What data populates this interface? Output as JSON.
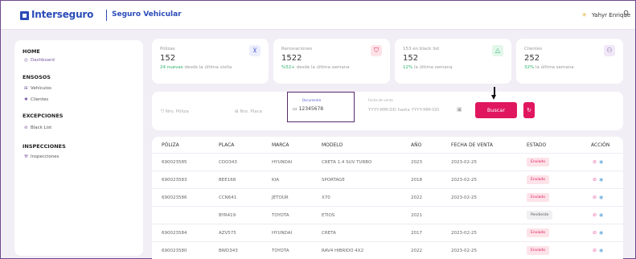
{
  "header": {
    "brand": "Interseguro",
    "product": "Seguro Vehicular",
    "user": "Yahyr Enrique"
  },
  "sidebar": {
    "sections": [
      {
        "title": "HOME",
        "items": [
          {
            "label": "Dashboard",
            "active": true,
            "icon": "dashboard-icon"
          }
        ]
      },
      {
        "title": "ENSOSOS",
        "items": [
          {
            "label": "Vehículos",
            "icon": "car-icon"
          },
          {
            "label": "Clientes",
            "icon": "users-icon"
          }
        ]
      },
      {
        "title": "EXCEPCIONES",
        "items": [
          {
            "label": "Black List",
            "icon": "block-icon"
          }
        ]
      },
      {
        "title": "INSPECCIONES",
        "items": [
          {
            "label": "Inspecciones",
            "icon": "wrench-icon"
          }
        ]
      }
    ]
  },
  "cards": [
    {
      "label": "Pólizas",
      "value": "152",
      "note_hl": "24 nuevas",
      "note": " desde la última visita",
      "icon_color": "#5a63d0",
      "icon_bg": "#eceefc",
      "hl_color": "#2db36c"
    },
    {
      "label": "Renovaciones",
      "value": "1522",
      "note_hl": "%52+",
      "note": " desde la última semana",
      "icon_color": "#e0175f",
      "icon_bg": "#fde3e8",
      "hl_color": "#2db36c"
    },
    {
      "label": "153 en black list",
      "value": "152",
      "note_hl": "12%",
      "note": " la última semana",
      "icon_color": "#2db36c",
      "icon_bg": "#e2f6ea",
      "hl_color": "#2db36c"
    },
    {
      "label": "Clientes",
      "value": "252",
      "note_hl": "32%",
      "note": " la última semana",
      "icon_color": "#7a5aa0",
      "icon_bg": "#f0e8f8",
      "hl_color": "#2db36c"
    }
  ],
  "filters": {
    "poliza_placeholder": "Nro. Póliza",
    "placa_placeholder": "Nro. Placa",
    "documento_label": "Documento",
    "documento_value": "12345678",
    "fecha_label": "Fecha de venta",
    "fecha_placeholder": "YYYY-MM-DD hasta YYYY-MM-DD",
    "search_label": "Buscar"
  },
  "table": {
    "columns": [
      "PÓLIZA",
      "PLACA",
      "MARCA",
      "MODELO",
      "AÑO",
      "FECHA DE VENTA",
      "ESTADO",
      "ACCIÓN"
    ],
    "rows": [
      {
        "poliza": "690023585",
        "placa": "CDO343",
        "marca": "HYUNDAI",
        "modelo": "CRETA 1.4 SUV TURBO",
        "anio": "2023",
        "fecha": "2023-02-25",
        "estado": "Enviado"
      },
      {
        "poliza": "690023583",
        "placa": "BEE168",
        "marca": "KIA",
        "modelo": "SPORTAGE",
        "anio": "2018",
        "fecha": "2023-02-25",
        "estado": "Enviado"
      },
      {
        "poliza": "690023586",
        "placa": "CCN641",
        "marca": "JETOUR",
        "modelo": "X70",
        "anio": "2022",
        "fecha": "2023-02-25",
        "estado": "Enviado"
      },
      {
        "poliza": "",
        "placa": "BYR419",
        "marca": "TOYOTA",
        "modelo": "ETIOS",
        "anio": "2021",
        "fecha": "",
        "estado": "Pendiente"
      },
      {
        "poliza": "690023584",
        "placa": "AZV575",
        "marca": "HYUNDAI",
        "modelo": "CRETA",
        "anio": "2017",
        "fecha": "2023-02-25",
        "estado": "Enviado"
      },
      {
        "poliza": "690023580",
        "placa": "BWD343",
        "marca": "TOYOTA",
        "modelo": "RAV4 HIBRIDO 4X2",
        "anio": "2022",
        "fecha": "2023-02-25",
        "estado": "Enviado"
      }
    ]
  },
  "colors": {
    "brand": "#2b4bb8",
    "accent": "#e0175f",
    "sidebar_active": "#7a5aa0"
  }
}
